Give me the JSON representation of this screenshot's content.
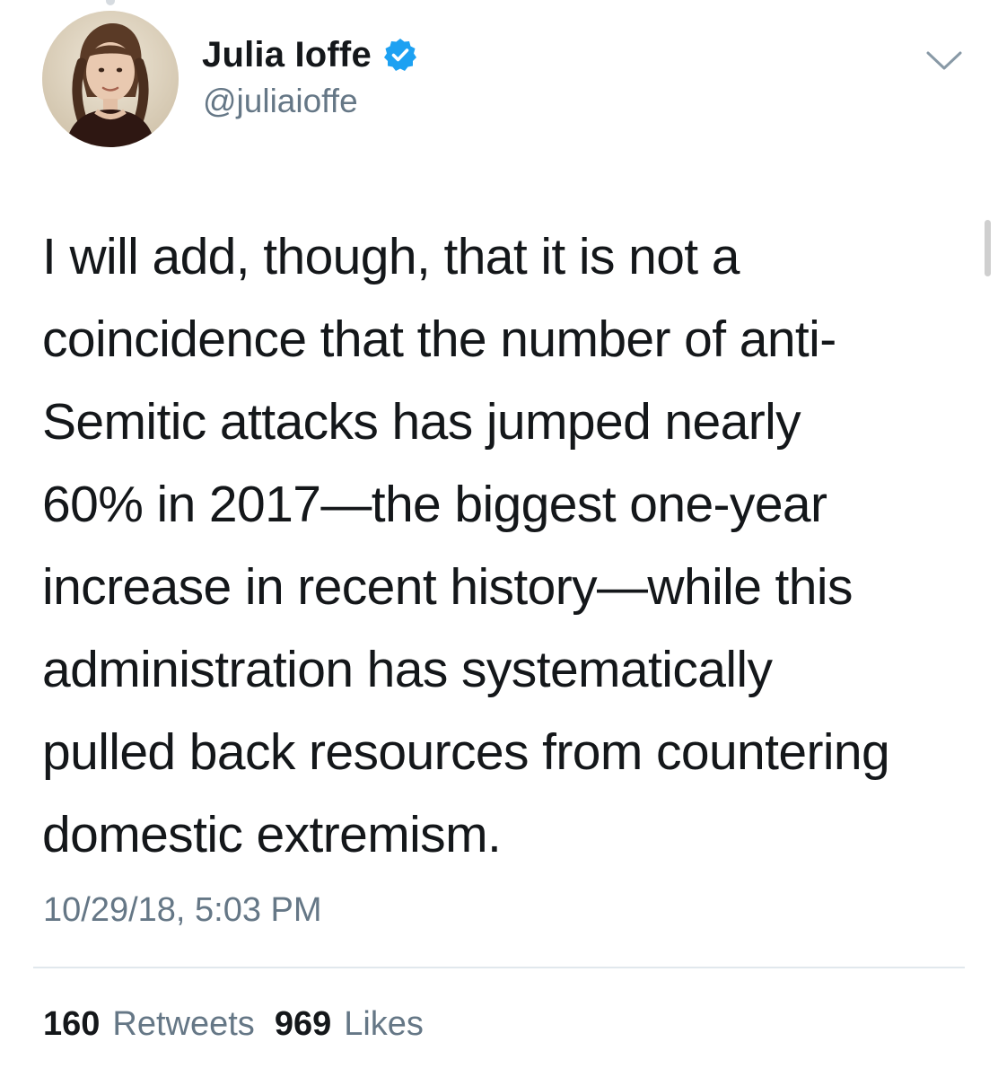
{
  "tweet": {
    "author": {
      "display_name": "Julia Ioffe",
      "handle": "@juliaioffe",
      "verified": true,
      "avatar_icon": "avatar-photo"
    },
    "menu_icon": "chevron-down-icon",
    "text_lines": [
      "I will add, though, that it is not a",
      "coincidence that the number of anti-",
      "Semitic attacks has jumped nearly",
      "60% in 2017—the biggest one-year",
      "increase in recent history—while this",
      "administration has systematically",
      "pulled back resources from countering",
      "domestic extremism."
    ],
    "timestamp": "10/29/18, 5:03 PM",
    "stats": {
      "retweets_count": "160",
      "retweets_label": "Retweets",
      "likes_count": "969",
      "likes_label": "Likes"
    }
  },
  "colors": {
    "verified_blue": "#1da1f2",
    "secondary_text": "#657786",
    "primary_text": "#14171a",
    "divider": "#e1e8ed"
  }
}
